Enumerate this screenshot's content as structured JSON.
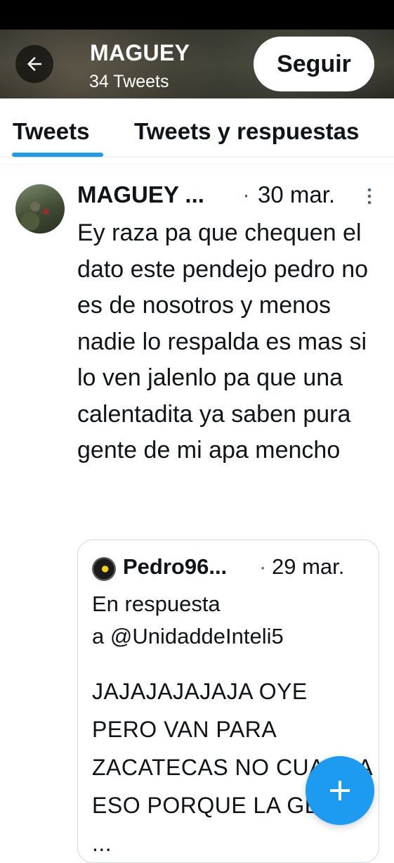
{
  "header": {
    "title": "MAGUEY",
    "subtitle": "34 Tweets",
    "follow_label": "Seguir"
  },
  "tabs": [
    {
      "label": "Tweets",
      "active": true
    },
    {
      "label": "Tweets y respuestas",
      "active": false
    }
  ],
  "tweet": {
    "author": "MAGUEY ...",
    "separator": "·",
    "date": "30 mar.",
    "text": "Ey raza pa que chequen el dato este pendejo pedro no es de nosotros y menos nadie lo respalda es mas si lo ven jalenlo pa que una calentadita ya saben pura gente de mi apa mencho",
    "quote": {
      "author": "Pedro96...",
      "separator": "·",
      "date": "29 mar.",
      "reply_line1": "En respuesta",
      "reply_line2": "a @UnidaddeInteli5",
      "text": "JAJAJAJAJAJA OYE PERO VAN PARA ZACATECAS NO CUADRA ESO PORQUE LA GENTE ..."
    }
  },
  "colors": {
    "accent": "#1d9bf0",
    "text": "#0f1419",
    "muted": "#536471",
    "border": "#cfd9de"
  },
  "icons": {
    "back": "arrow-left-icon",
    "more": "more-vertical-icon",
    "compose": "plus-icon"
  }
}
